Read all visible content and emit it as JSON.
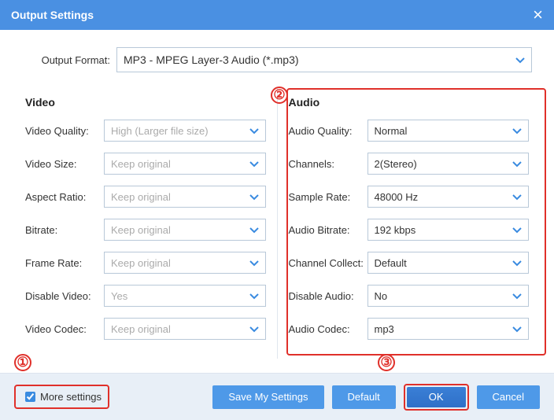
{
  "title": "Output Settings",
  "format": {
    "label": "Output Format:",
    "value": "MP3 - MPEG Layer-3 Audio (*.mp3)"
  },
  "video": {
    "heading": "Video",
    "rows": {
      "quality": {
        "label": "Video Quality:",
        "value": "High (Larger file size)",
        "disabled": true
      },
      "size": {
        "label": "Video Size:",
        "value": "Keep original",
        "disabled": true
      },
      "aspect": {
        "label": "Aspect Ratio:",
        "value": "Keep original",
        "disabled": true
      },
      "bitrate": {
        "label": "Bitrate:",
        "value": "Keep original",
        "disabled": true
      },
      "fps": {
        "label": "Frame Rate:",
        "value": "Keep original",
        "disabled": true
      },
      "disable": {
        "label": "Disable Video:",
        "value": "Yes",
        "disabled": true
      },
      "codec": {
        "label": "Video Codec:",
        "value": "Keep original",
        "disabled": true
      }
    }
  },
  "audio": {
    "heading": "Audio",
    "rows": {
      "quality": {
        "label": "Audio Quality:",
        "value": "Normal"
      },
      "channels": {
        "label": "Channels:",
        "value": "2(Stereo)"
      },
      "rate": {
        "label": "Sample Rate:",
        "value": "48000 Hz"
      },
      "bitrate": {
        "label": "Audio Bitrate:",
        "value": "192 kbps"
      },
      "collect": {
        "label": "Channel Collect:",
        "value": "Default"
      },
      "disable": {
        "label": "Disable Audio:",
        "value": "No"
      },
      "codec": {
        "label": "Audio Codec:",
        "value": "mp3"
      }
    }
  },
  "footer": {
    "more": "More settings",
    "save": "Save My Settings",
    "default": "Default",
    "ok": "OK",
    "cancel": "Cancel"
  },
  "markers": {
    "m1": "①",
    "m2": "②",
    "m3": "③"
  }
}
